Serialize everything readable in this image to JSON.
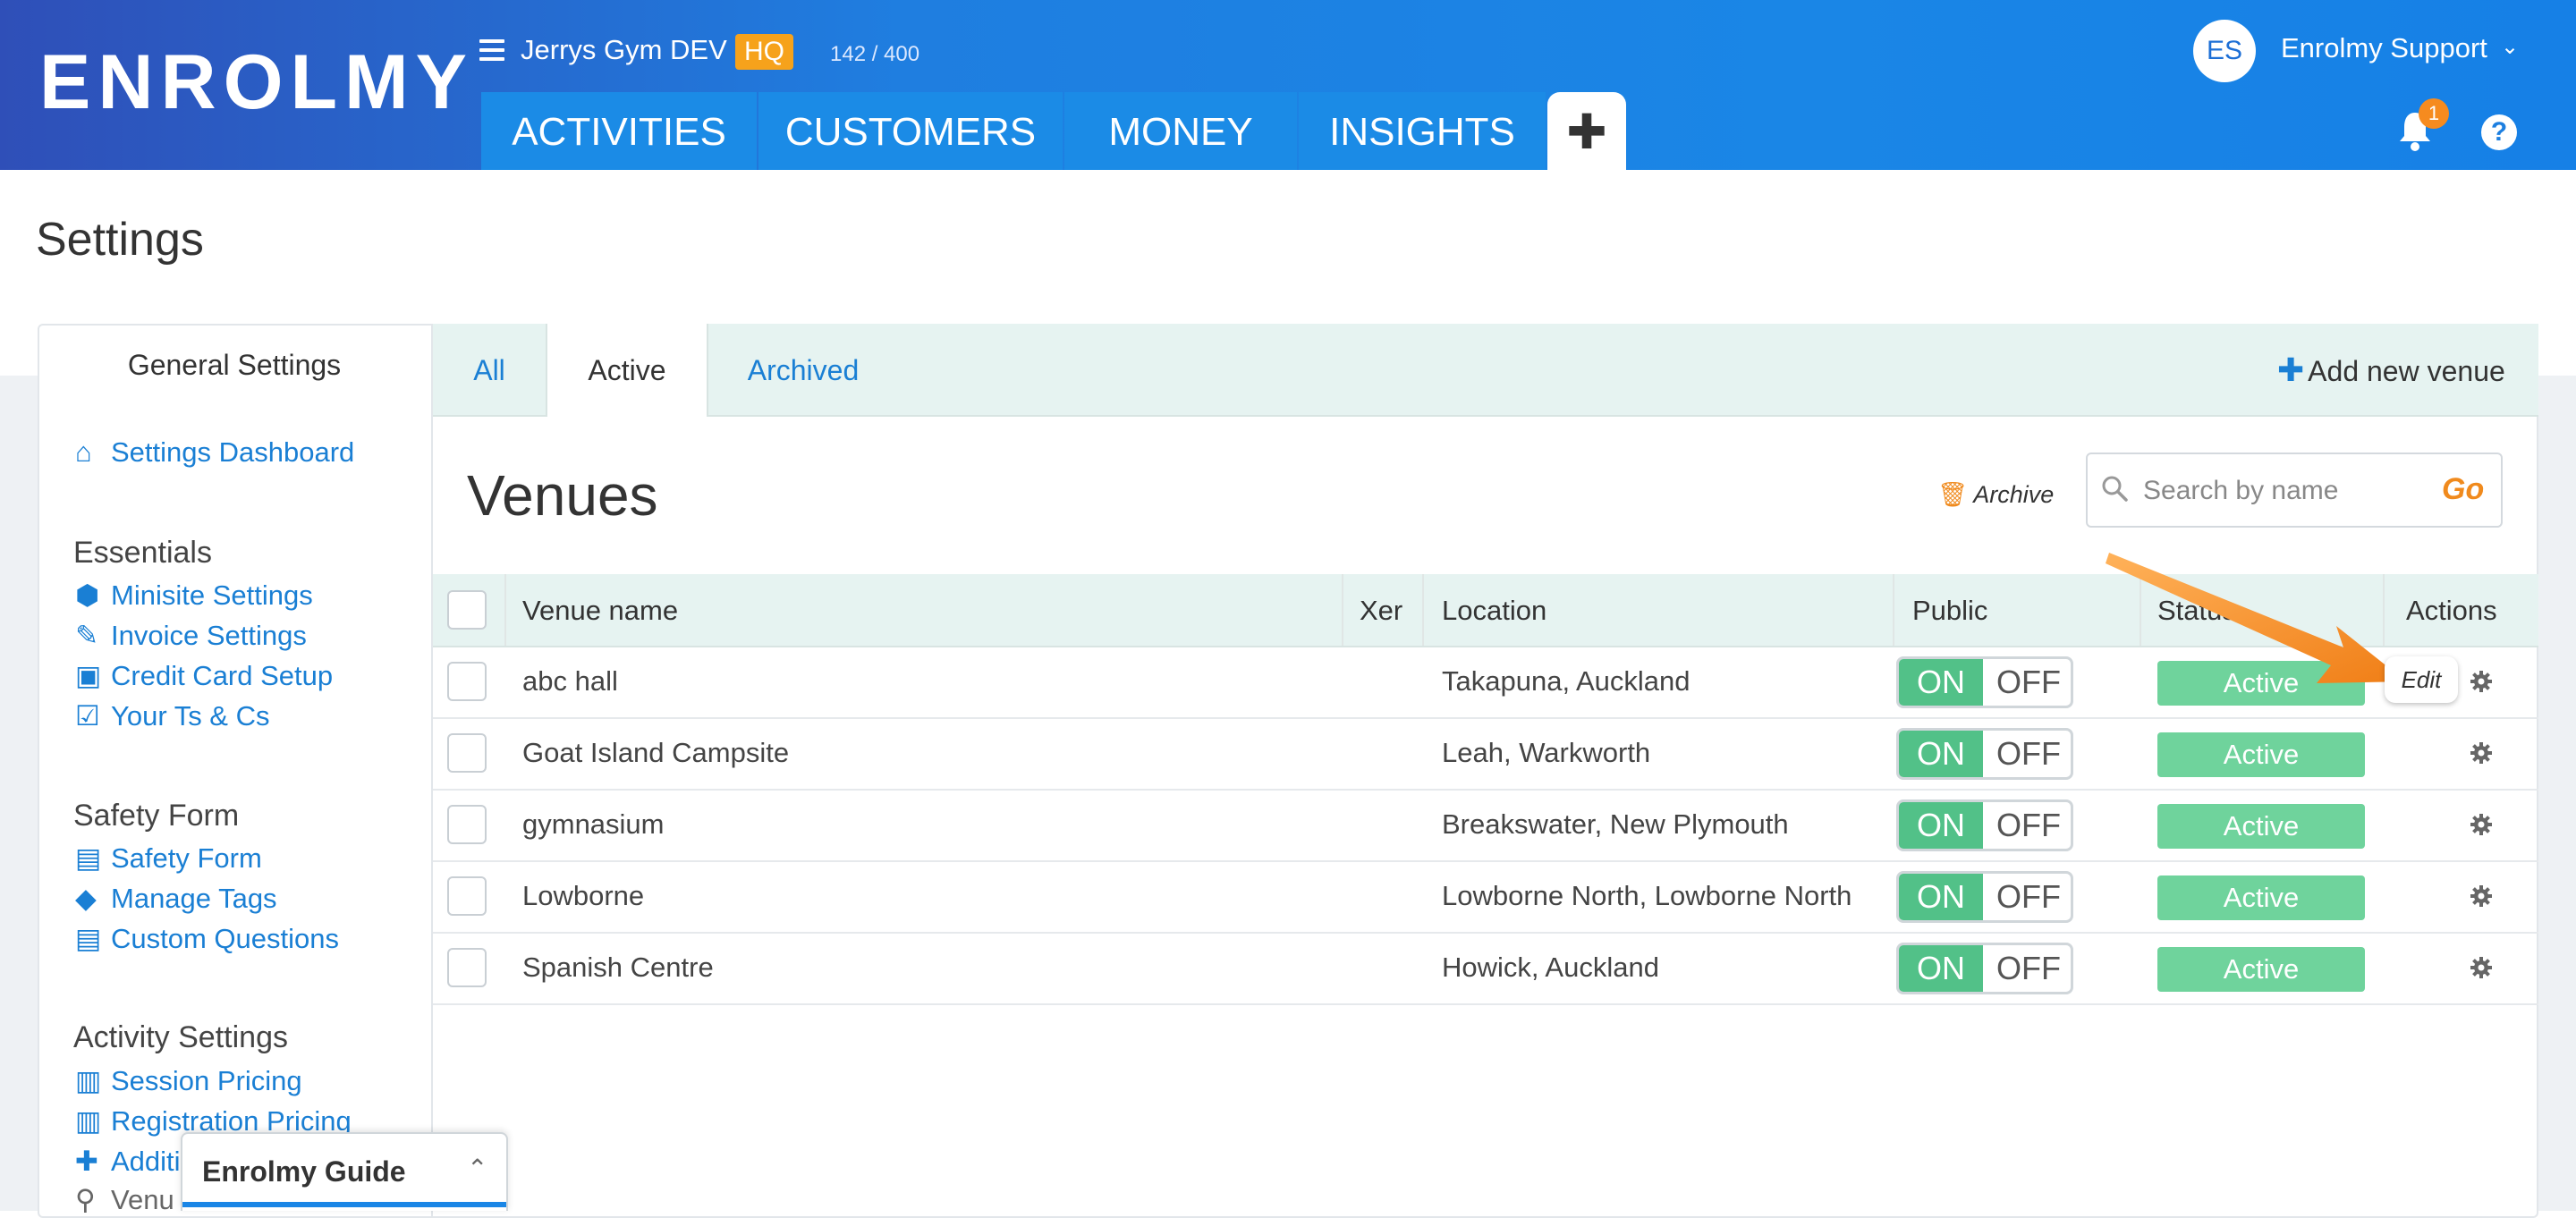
{
  "header": {
    "logo_text": "ENROLMY",
    "gym_name": "Jerrys Gym DEV",
    "hq_badge": "HQ",
    "count": "142 / 400",
    "nav_tabs": [
      "ACTIVITIES",
      "CUSTOMERS",
      "MONEY",
      "INSIGHTS"
    ],
    "plus_label": "✚",
    "user_initials": "ES",
    "user_name": "Enrolmy Support",
    "notification_count": "1",
    "help_label": "?"
  },
  "page": {
    "title": "Settings"
  },
  "sidebar": {
    "title": "General Settings",
    "dashboard": "Settings Dashboard",
    "essentials_head": "Essentials",
    "essentials": [
      "Minisite Settings",
      "Invoice Settings",
      "Credit Card Setup",
      "Your Ts & Cs"
    ],
    "safety_head": "Safety Form",
    "safety": [
      "Safety Form",
      "Manage Tags",
      "Custom Questions"
    ],
    "activity_head": "Activity Settings",
    "activity": [
      "Session Pricing",
      "Registration Pricing",
      "Additi",
      "Venu"
    ]
  },
  "tabs": {
    "all": "All",
    "active": "Active",
    "archived": "Archived",
    "add_venue": "Add new venue"
  },
  "venues": {
    "title": "Venues",
    "archive_label": "Archive",
    "search_placeholder": "Search by name",
    "go_label": "Go",
    "columns": [
      "Venue name",
      "Xer",
      "Location",
      "Public",
      "Status",
      "Actions"
    ],
    "toggle_on": "ON",
    "toggle_off": "OFF",
    "rows": [
      {
        "name": "abc hall",
        "location": "Takapuna, Auckland",
        "status": "Active"
      },
      {
        "name": "Goat Island Campsite",
        "location": "Leah, Warkworth",
        "status": "Active"
      },
      {
        "name": "gymnasium",
        "location": "Breakswater, New Plymouth",
        "status": "Active"
      },
      {
        "name": "Lowborne",
        "location": "Lowborne North, Lowborne North",
        "status": "Active"
      },
      {
        "name": "Spanish Centre",
        "location": "Howick, Auckland",
        "status": "Active"
      }
    ],
    "edit_tooltip": "Edit"
  },
  "guide": {
    "title": "Enrolmy Guide"
  },
  "colors": {
    "accent": "#1a86e6",
    "orange": "#f08a1d",
    "green": "#52c188",
    "status": "#6fd39c"
  }
}
